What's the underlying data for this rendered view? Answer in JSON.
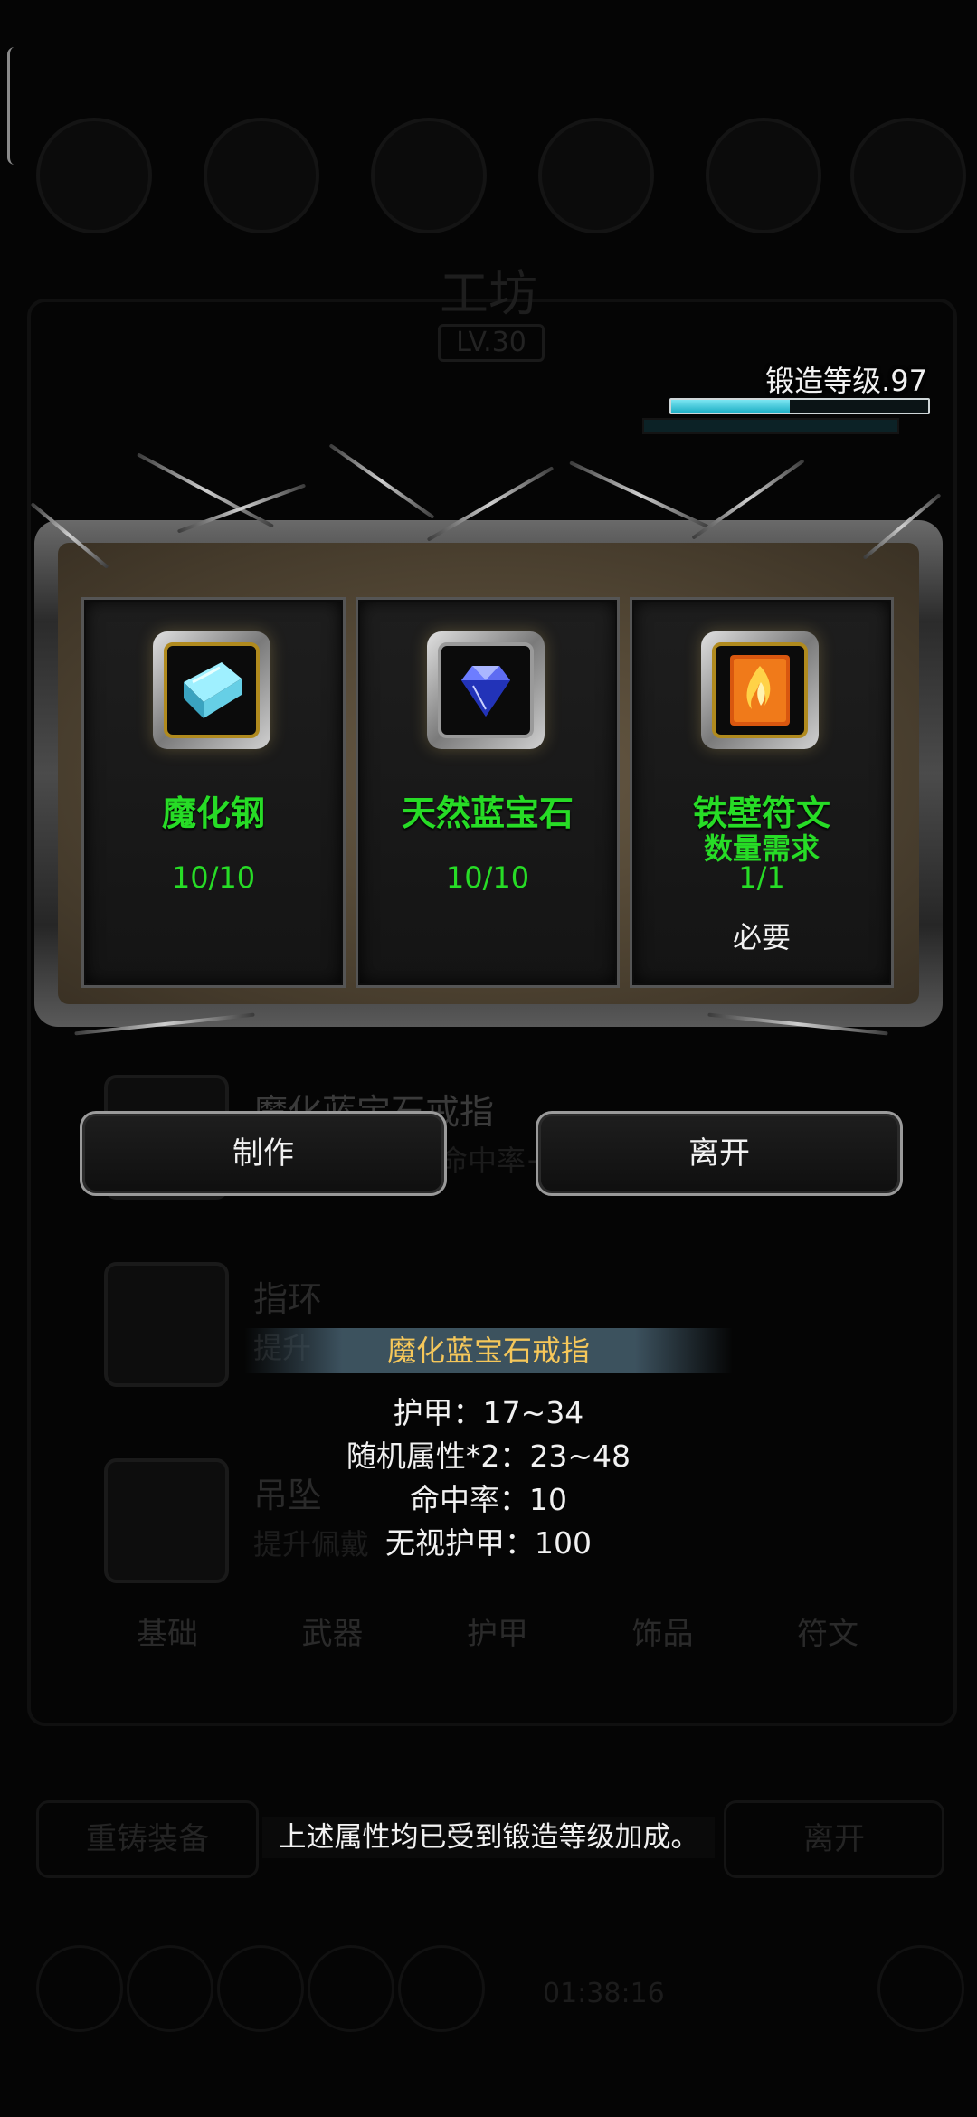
{
  "background": {
    "title": "工坊",
    "level_badge": "LV.30",
    "list_items": [
      {
        "name": "魔化蓝宝石戒指",
        "desc": "命中率+"
      },
      {
        "name": "指环",
        "desc": "提升"
      },
      {
        "name": "吊坠",
        "desc": "提升佩戴"
      }
    ],
    "tabs": [
      "基础",
      "武器",
      "护甲",
      "饰品",
      "符文"
    ],
    "left_button": "重铸装备",
    "right_button": "离开",
    "time": "01:38:16"
  },
  "forge": {
    "label": "锻造等级.97",
    "progress": 0.46
  },
  "materials": [
    {
      "name": "魔化钢",
      "sub": "",
      "count": "10/10",
      "requirement": "",
      "icon": "steel-ingot-icon"
    },
    {
      "name": "天然蓝宝石",
      "sub": "",
      "count": "10/10",
      "requirement": "",
      "icon": "sapphire-gem-icon"
    },
    {
      "name": "铁壁符文",
      "sub": "数量需求",
      "count": "1/1",
      "requirement": "必要",
      "icon": "fire-rune-icon"
    }
  ],
  "actions": {
    "craft": "制作",
    "leave": "离开"
  },
  "tooltip": {
    "item_name": "魔化蓝宝石戒指",
    "stats": [
      "护甲：17~34",
      "随机属性*2：23~48",
      "命中率：10",
      "无视护甲：100"
    ],
    "note": "上述属性均已受到锻造等级加成。"
  },
  "colors": {
    "material_text": "#27dc26",
    "tooltip_title": "#f5c75a",
    "forge_bar": "#1fb0c6",
    "icon_gold_border": "#b08a1e"
  }
}
